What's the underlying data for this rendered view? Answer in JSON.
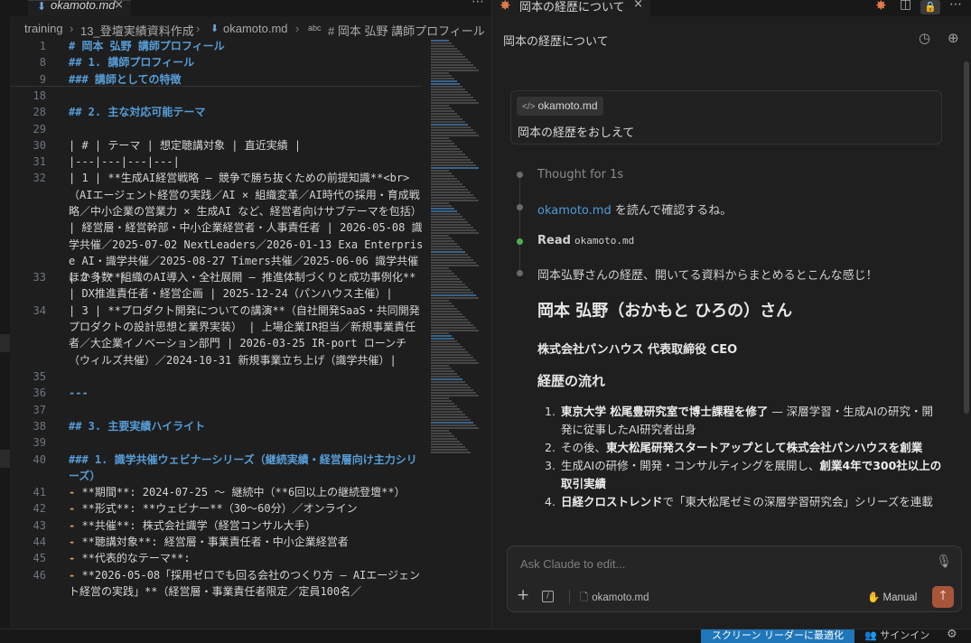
{
  "editor": {
    "tab": {
      "filename": "okamoto.md",
      "file_icon": "markdown-icon",
      "close": "×"
    },
    "tab_more": "⋯",
    "breadcrumb": [
      "training",
      "13_登壇実績資料作成",
      "okamoto.md",
      "# 岡本 弘野 講師プロフィール"
    ],
    "breadcrumb_icons": [
      "chevron-right-icon",
      "markdown-icon",
      "heading-icon"
    ],
    "lines": [
      {
        "n": "1",
        "kind": "h",
        "text": "# 岡本 弘野 講師プロフィール"
      },
      {
        "n": "8",
        "kind": "h",
        "text": "## 1. 講師プロフィール"
      },
      {
        "n": "9",
        "kind": "h",
        "text": "### 講師としての特徴"
      },
      {
        "n": "18",
        "kind": "p",
        "text": ""
      },
      {
        "n": "28",
        "kind": "h",
        "text": "## 2. 主な対応可能テーマ"
      },
      {
        "n": "29",
        "kind": "p",
        "text": ""
      },
      {
        "n": "30",
        "kind": "p",
        "text": "| # | テーマ | 想定聴講対象 | 直近実績 |"
      },
      {
        "n": "31",
        "kind": "p",
        "text": "|---|---|---|---|"
      },
      {
        "n": "32",
        "kind": "p",
        "text": "| 1 | **生成AI経営戦略 — 競争で勝ち抜くための前提知識**<br>（AIエージェント経営の実践／AI × 組織変革／AI時代の採用・育成戦略／中小企業の営業力 × 生成AI など、経営者向けサブテーマを包括） | 経営層・経営幹部・中小企業経営者・人事責任者 | 2026-05-08 識学共催／2025-07-02 NextLeaders／2026-01-13 Exa Enterprise AI・識学共催／2025-08-27 Timers共催／2025-06-06 識学共催 ほか多数 |"
      },
      {
        "n": "33",
        "kind": "p",
        "text": "| 2 | **組織のAI導入・全社展開 — 推進体制づくりと成功事例化** | DX推進責任者・経営企画 | 2025-12-24（パンハウス主催）|"
      },
      {
        "n": "34",
        "kind": "p",
        "text": "| 3 | **プロダクト開発についての講演**（自社開発SaaS・共同開発プロダクトの設計思想と業界実装） | 上場企業IR担当／新規事業責任者／大企業イノベーション部門 | 2026-03-25 IR-port ローンチ（ウィルズ共催）／2024-10-31 新規事業立ち上げ（識学共催）|"
      },
      {
        "n": "35",
        "kind": "p",
        "text": ""
      },
      {
        "n": "36",
        "kind": "h",
        "text": "---"
      },
      {
        "n": "37",
        "kind": "p",
        "text": ""
      },
      {
        "n": "38",
        "kind": "h",
        "text": "## 3. 主要実績ハイライト"
      },
      {
        "n": "39",
        "kind": "p",
        "text": ""
      },
      {
        "n": "40",
        "kind": "h",
        "text": "### 1. 識学共催ウェビナーシリーズ（継続実績・経営層向け主力シリーズ）"
      },
      {
        "n": "41",
        "kind": "li",
        "text": "**期間**: 2024-07-25 〜 継続中（**6回以上の継続登壇**）"
      },
      {
        "n": "42",
        "kind": "li",
        "text": "**形式**: **ウェビナー**（30〜60分）／オンライン"
      },
      {
        "n": "43",
        "kind": "li",
        "text": "**共催**: 株式会社識学（経営コンサル大手）"
      },
      {
        "n": "44",
        "kind": "li",
        "text": "**聴講対象**: 経営層・事業責任者・中小企業経営者"
      },
      {
        "n": "45",
        "kind": "li",
        "text": "**代表的なテーマ**:"
      },
      {
        "n": "46",
        "kind": "li2",
        "text": "**2026-05-08「採用ゼロでも回る会社のつくり方 — AIエージェント経営の実践」**（経営層・事業責任者限定／定員100名／"
      }
    ]
  },
  "panel": {
    "tab_title": "岡本の経歴について",
    "tab_icon": "claude-star-icon",
    "conversation_title": "岡本の経歴について",
    "header_icons": [
      "history-icon",
      "new-chat-icon"
    ],
    "user_message": {
      "file_chip": "okamoto.md",
      "text": "岡本の経歴をおしえて"
    },
    "steps": {
      "thought": "Thought for 1s",
      "read_link": "okamoto.md",
      "read_suffix": " を読んで確認するね。",
      "read_label": "Read",
      "read_file": "okamoto.md",
      "summary": "岡本弘野さんの経歴、開いてる資料からまとめるとこんな感じ！"
    },
    "response": {
      "name": "岡本 弘野（おかもと ひろの）さん",
      "company": "株式会社パンハウス 代表取締役 CEO",
      "section": "経歴の流れ",
      "items": [
        {
          "num": "1.",
          "bold": "東京大学 松尾豊研究室で博士課程を修了",
          "rest": " — 深層学習・生成AIの研究・開発に従事したAI研究者出身"
        },
        {
          "num": "2.",
          "pre": "その後、",
          "bold": "東大松尾研発スタートアップとして株式会社パンハウスを創業",
          "rest": ""
        },
        {
          "num": "3.",
          "pre": "生成AIの研修・開発・コンサルティングを展開し、",
          "bold": "創業4年で300社以上の取引実績",
          "rest": ""
        },
        {
          "num": "4.",
          "bold": "日経クロストレンド",
          "rest": "で「東大松尾ゼミの深層学習研究会」シリーズを連載"
        }
      ]
    },
    "input": {
      "placeholder": "Ask Claude to edit...",
      "context_file": "okamoto.md",
      "mode": "Manual",
      "plus": "+",
      "send": "↑"
    }
  },
  "statusbar": {
    "screen_reader": "スクリーン リーダーに最適化",
    "signin": "サインイン"
  },
  "colors": {
    "accent_orange": "#e07a4b",
    "link_blue": "#4e9bd8",
    "heading_blue": "#569cd6",
    "list_marker": "#d7a15b",
    "status_blue": "#1f76b8",
    "send_button": "#a8553a"
  }
}
